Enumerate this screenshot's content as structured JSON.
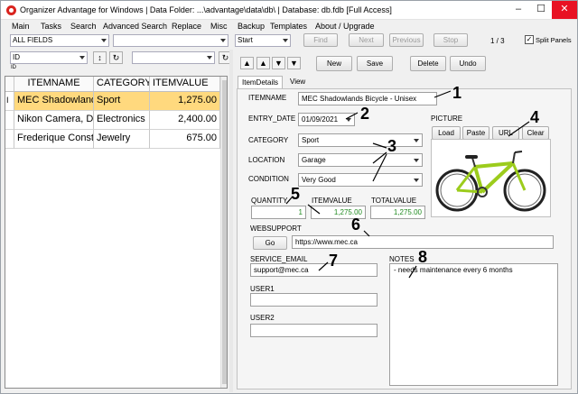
{
  "window": {
    "title": "Organizer Advantage for Windows | Data Folder: ...\\advantage\\data\\db\\ | Database: db.fdb [Full Access]",
    "min": "–",
    "max": "☐",
    "close": "✕"
  },
  "menu": [
    "Main",
    "Tasks",
    "Search",
    "Advanced Search",
    "Replace",
    "Misc",
    "Backup",
    "Templates",
    "About / Upgrade"
  ],
  "toolbar": {
    "field_select": "ALL FIELDS",
    "search_value": "",
    "mode_select": "Start",
    "find": "Find",
    "next": "Next",
    "previous": "Previous",
    "stop": "Stop",
    "record_counter": "1 / 3",
    "split_panels": "Split Panels",
    "split_checked": "✓"
  },
  "sort": {
    "field": "ID",
    "field_label": "ID",
    "direction": "↕",
    "refresh": "↻",
    "filter": "",
    "filter_refresh": "↻"
  },
  "nav": {
    "first": "▲",
    "prev": "▲",
    "next": "▼",
    "last": "▼",
    "new": "New",
    "save": "Save",
    "delete": "Delete",
    "undo": "Undo"
  },
  "grid": {
    "row_indicator": "I",
    "columns": [
      "ITEMNAME",
      "CATEGORY",
      "ITEMVALUE"
    ],
    "rows": [
      {
        "name": "MEC Shadowlands",
        "category": "Sport",
        "value": "1,275.00"
      },
      {
        "name": "Nikon Camera, D",
        "category": "Electronics",
        "value": "2,400.00"
      },
      {
        "name": "Frederique Const",
        "category": "Jewelry",
        "value": "675.00"
      }
    ]
  },
  "tabs": [
    "ItemDetails",
    "View"
  ],
  "form": {
    "itemname_label": "ITEMNAME",
    "itemname": "MEC Shadowlands Bicycle - Unisex",
    "entry_date_label": "ENTRY_DATE",
    "entry_date": "01/09/2021",
    "category_label": "CATEGORY",
    "category": "Sport",
    "location_label": "LOCATION",
    "location": "Garage",
    "condition_label": "CONDITION",
    "condition": "Very Good",
    "quantity_label": "QUANTITY",
    "quantity": "1",
    "itemvalue_label": "ITEMVALUE",
    "itemvalue": "1,275.00",
    "totalvalue_label": "TOTALVALUE",
    "totalvalue": "1,275.00",
    "websupport_label": "WEBSUPPORT",
    "go": "Go",
    "websupport": "https://www.mec.ca",
    "service_email_label": "SERVICE_EMAIL",
    "service_email": "support@mec.ca",
    "user1_label": "USER1",
    "user1": "",
    "user2_label": "USER2",
    "user2": "",
    "notes_label": "NOTES",
    "notes": "- needs maintenance every 6 months",
    "picture_label": "PICTURE",
    "load": "Load",
    "paste": "Paste",
    "url": "URL",
    "clear": "Clear"
  },
  "annotations": [
    "1",
    "2",
    "3",
    "4",
    "5",
    "6",
    "7",
    "8"
  ],
  "colors": {
    "selection": "#ffd97e",
    "value_green": "#1e8a1e",
    "close_red": "#e81123"
  }
}
